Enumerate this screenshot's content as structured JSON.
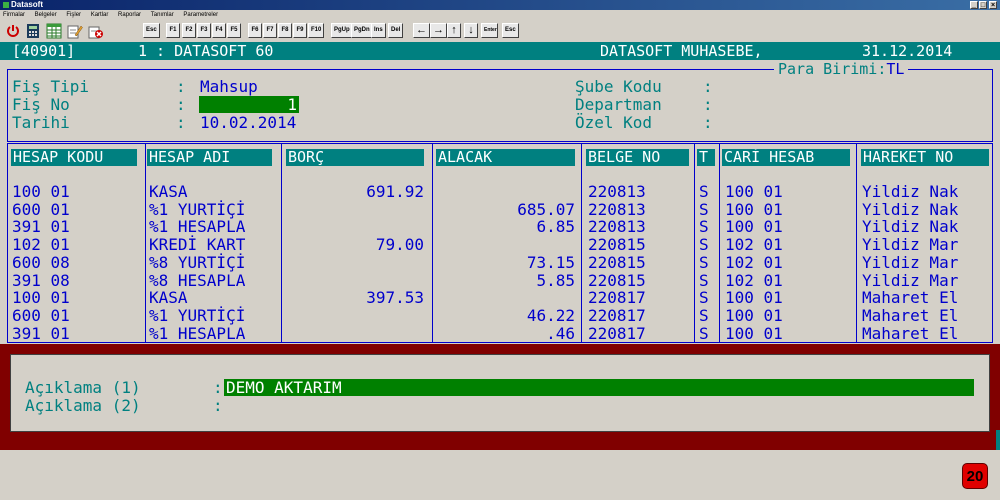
{
  "window": {
    "title": "Datasoft",
    "buttons": [
      "_",
      "□",
      "×"
    ]
  },
  "menu": [
    "Firmalar",
    "Belgeler",
    "Fişler",
    "Kartlar",
    "Raporlar",
    "Tanımlar",
    "Parametreler"
  ],
  "toolbar": {
    "icons": [
      "power-icon",
      "calculator-icon",
      "spreadsheet-icon",
      "edit-note-icon",
      "delete-record-icon"
    ],
    "keys1": [
      "Esc",
      "F1",
      "F2",
      "F3",
      "F4",
      "F5"
    ],
    "keys2": [
      "F6",
      "F7",
      "F8",
      "F9",
      "F10"
    ],
    "keys3": [
      "PgUp",
      "PgDn",
      "Ins",
      "Del"
    ],
    "arrows": [
      "←",
      "→",
      "↑",
      "↓"
    ],
    "enter_label": "Enter",
    "esc_label": "Esc"
  },
  "header": {
    "code": "[40901]",
    "company": "1 : DATASOFT 60",
    "app": "DATASOFT MUHASEBE,",
    "date": "31.12.2014"
  },
  "form": {
    "para_birimi_label": "Para Birimi:",
    "para_birimi_value": "TL",
    "fis_tipi_label": "Fiş Tipi",
    "fis_tipi_value": "Mahsup",
    "fis_no_label": "Fiş No",
    "fis_no_value": "1",
    "tarih_label": "Tarihi",
    "tarih_value": "10.02.2014",
    "sube_label": "Şube Kodu",
    "departman_label": "Departman",
    "ozel_kod_label": "Özel Kod",
    "colon": ":"
  },
  "table": {
    "headers": [
      "HESAP KODU",
      "HESAP ADI",
      "BORÇ",
      "ALACAK",
      "BELGE NO",
      "T",
      "CARİ HESAB",
      "HAREKET NO"
    ],
    "rows": [
      {
        "kod": "100 01",
        "ad": "KASA",
        "borc": "691.92",
        "alacak": "",
        "belge": "220813",
        "t": "S",
        "cari": "100 01",
        "hareket": "Yildiz Nak"
      },
      {
        "kod": "600 01",
        "ad": "%1 YURTİÇİ",
        "borc": "",
        "alacak": "685.07",
        "belge": "220813",
        "t": "S",
        "cari": "100 01",
        "hareket": "Yildiz Nak"
      },
      {
        "kod": "391 01",
        "ad": "%1 HESAPLA",
        "borc": "",
        "alacak": "6.85",
        "belge": "220813",
        "t": "S",
        "cari": "100 01",
        "hareket": "Yildiz Nak"
      },
      {
        "kod": "102 01",
        "ad": "KREDİ KART",
        "borc": "79.00",
        "alacak": "",
        "belge": "220815",
        "t": "S",
        "cari": "102 01",
        "hareket": "Yildiz Mar"
      },
      {
        "kod": "600 08",
        "ad": "%8 YURTİÇİ",
        "borc": "",
        "alacak": "73.15",
        "belge": "220815",
        "t": "S",
        "cari": "102 01",
        "hareket": "Yildiz Mar"
      },
      {
        "kod": "391 08",
        "ad": "%8 HESAPLA",
        "borc": "",
        "alacak": "5.85",
        "belge": "220815",
        "t": "S",
        "cari": "102 01",
        "hareket": "Yildiz Mar"
      },
      {
        "kod": "100 01",
        "ad": "KASA",
        "borc": "397.53",
        "alacak": "",
        "belge": "220817",
        "t": "S",
        "cari": "100 01",
        "hareket": "Maharet El"
      },
      {
        "kod": "600 01",
        "ad": "%1 YURTİÇİ",
        "borc": "",
        "alacak": "46.22",
        "belge": "220817",
        "t": "S",
        "cari": "100 01",
        "hareket": "Maharet El"
      },
      {
        "kod": "391 01",
        "ad": "%1 HESAPLA",
        "borc": "",
        "alacak": ".46",
        "belge": "220817",
        "t": "S",
        "cari": "100 01",
        "hareket": "Maharet El"
      }
    ]
  },
  "aciklama": {
    "label1": "Açıklama (1)",
    "label2": "Açıklama (2)",
    "colon": ":",
    "value1": "DEMO AKTARIM",
    "value2": ""
  },
  "badge": "20",
  "colors": {
    "teal": "#008080",
    "blue": "#0000cc",
    "green": "#008000",
    "maroon": "#800000",
    "badge_red": "#e00000"
  }
}
